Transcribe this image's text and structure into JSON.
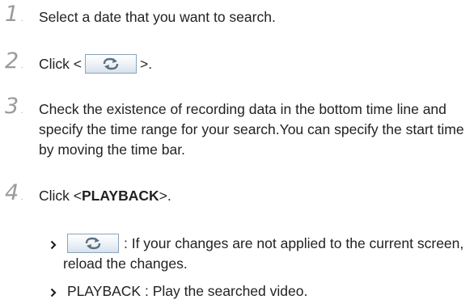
{
  "steps": [
    {
      "num": "1",
      "text": "Select a date that you want to search."
    },
    {
      "num": "2",
      "prefix": "Click <",
      "suffix": ">."
    },
    {
      "num": "3",
      "text": "Check the existence of recording data in the bottom time line and specify the time range for your search.You can specify the start time by moving the time bar."
    },
    {
      "num": "4",
      "prefix": "Click <",
      "bold": "PLAYBACK",
      "suffix": ">."
    }
  ],
  "bullets": [
    {
      "text": ": If your changes are not applied to the current screen, reload the changes.",
      "icon": "refresh-icon"
    },
    {
      "text": "PLAYBACK : Play the searched video."
    }
  ],
  "colors": {
    "step_number": "#9a9a9a",
    "text": "#222222",
    "button_border": "#8aa3ba",
    "icon": "#5b6e7e"
  }
}
